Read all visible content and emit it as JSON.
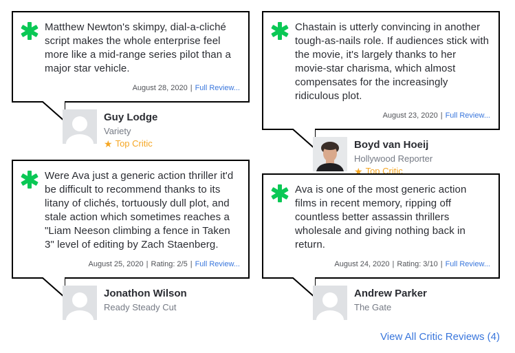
{
  "reviews": [
    {
      "quote": "Matthew Newton's skimpy, dial-a-cliché script makes the whole enterprise feel more like a mid-range series pilot than a major star vehicle.",
      "date": "August 28, 2020",
      "rating": "",
      "full_review": "Full Review...",
      "critic_name": "Guy Lodge",
      "publication": "Variety",
      "top_critic": "Top Critic",
      "avatar": "placeholder"
    },
    {
      "quote": "Chastain is utterly convincing in another tough-as-nails role. If audiences stick with the movie, it's largely thanks to her movie-star charisma, which almost compensates for the increasingly ridiculous plot.",
      "date": "August 23, 2020",
      "rating": "",
      "full_review": "Full Review...",
      "critic_name": "Boyd van Hoeij",
      "publication": "Hollywood Reporter",
      "top_critic": "Top Critic",
      "avatar": "photo"
    },
    {
      "quote": "Were Ava just a generic action thriller it'd be difficult to recommend thanks to its litany of clichés, tortuously dull plot, and stale action which sometimes reaches a \"Liam Neeson climbing a fence in Taken 3\" level of editing by Zach Staenberg.",
      "date": "August 25, 2020",
      "rating": "Rating: 2/5",
      "full_review": "Full Review...",
      "critic_name": "Jonathon Wilson",
      "publication": "Ready Steady Cut",
      "top_critic": "",
      "avatar": "placeholder"
    },
    {
      "quote": "Ava is one of the most generic action films in recent memory, ripping off countless better assassin thrillers wholesale and giving nothing back in return.",
      "date": "August 24, 2020",
      "rating": "Rating: 3/10",
      "full_review": "Full Review...",
      "critic_name": "Andrew Parker",
      "publication": "The Gate",
      "top_critic": "",
      "avatar": "placeholder"
    }
  ],
  "separator": "|",
  "view_all": "View All Critic Reviews (4)",
  "colors": {
    "splat": "#0ac855",
    "link": "#3976dc",
    "top_critic": "#f5a623",
    "border": "#000000"
  },
  "icons": {
    "splat": "rotten-splat-icon",
    "star": "star-icon"
  }
}
